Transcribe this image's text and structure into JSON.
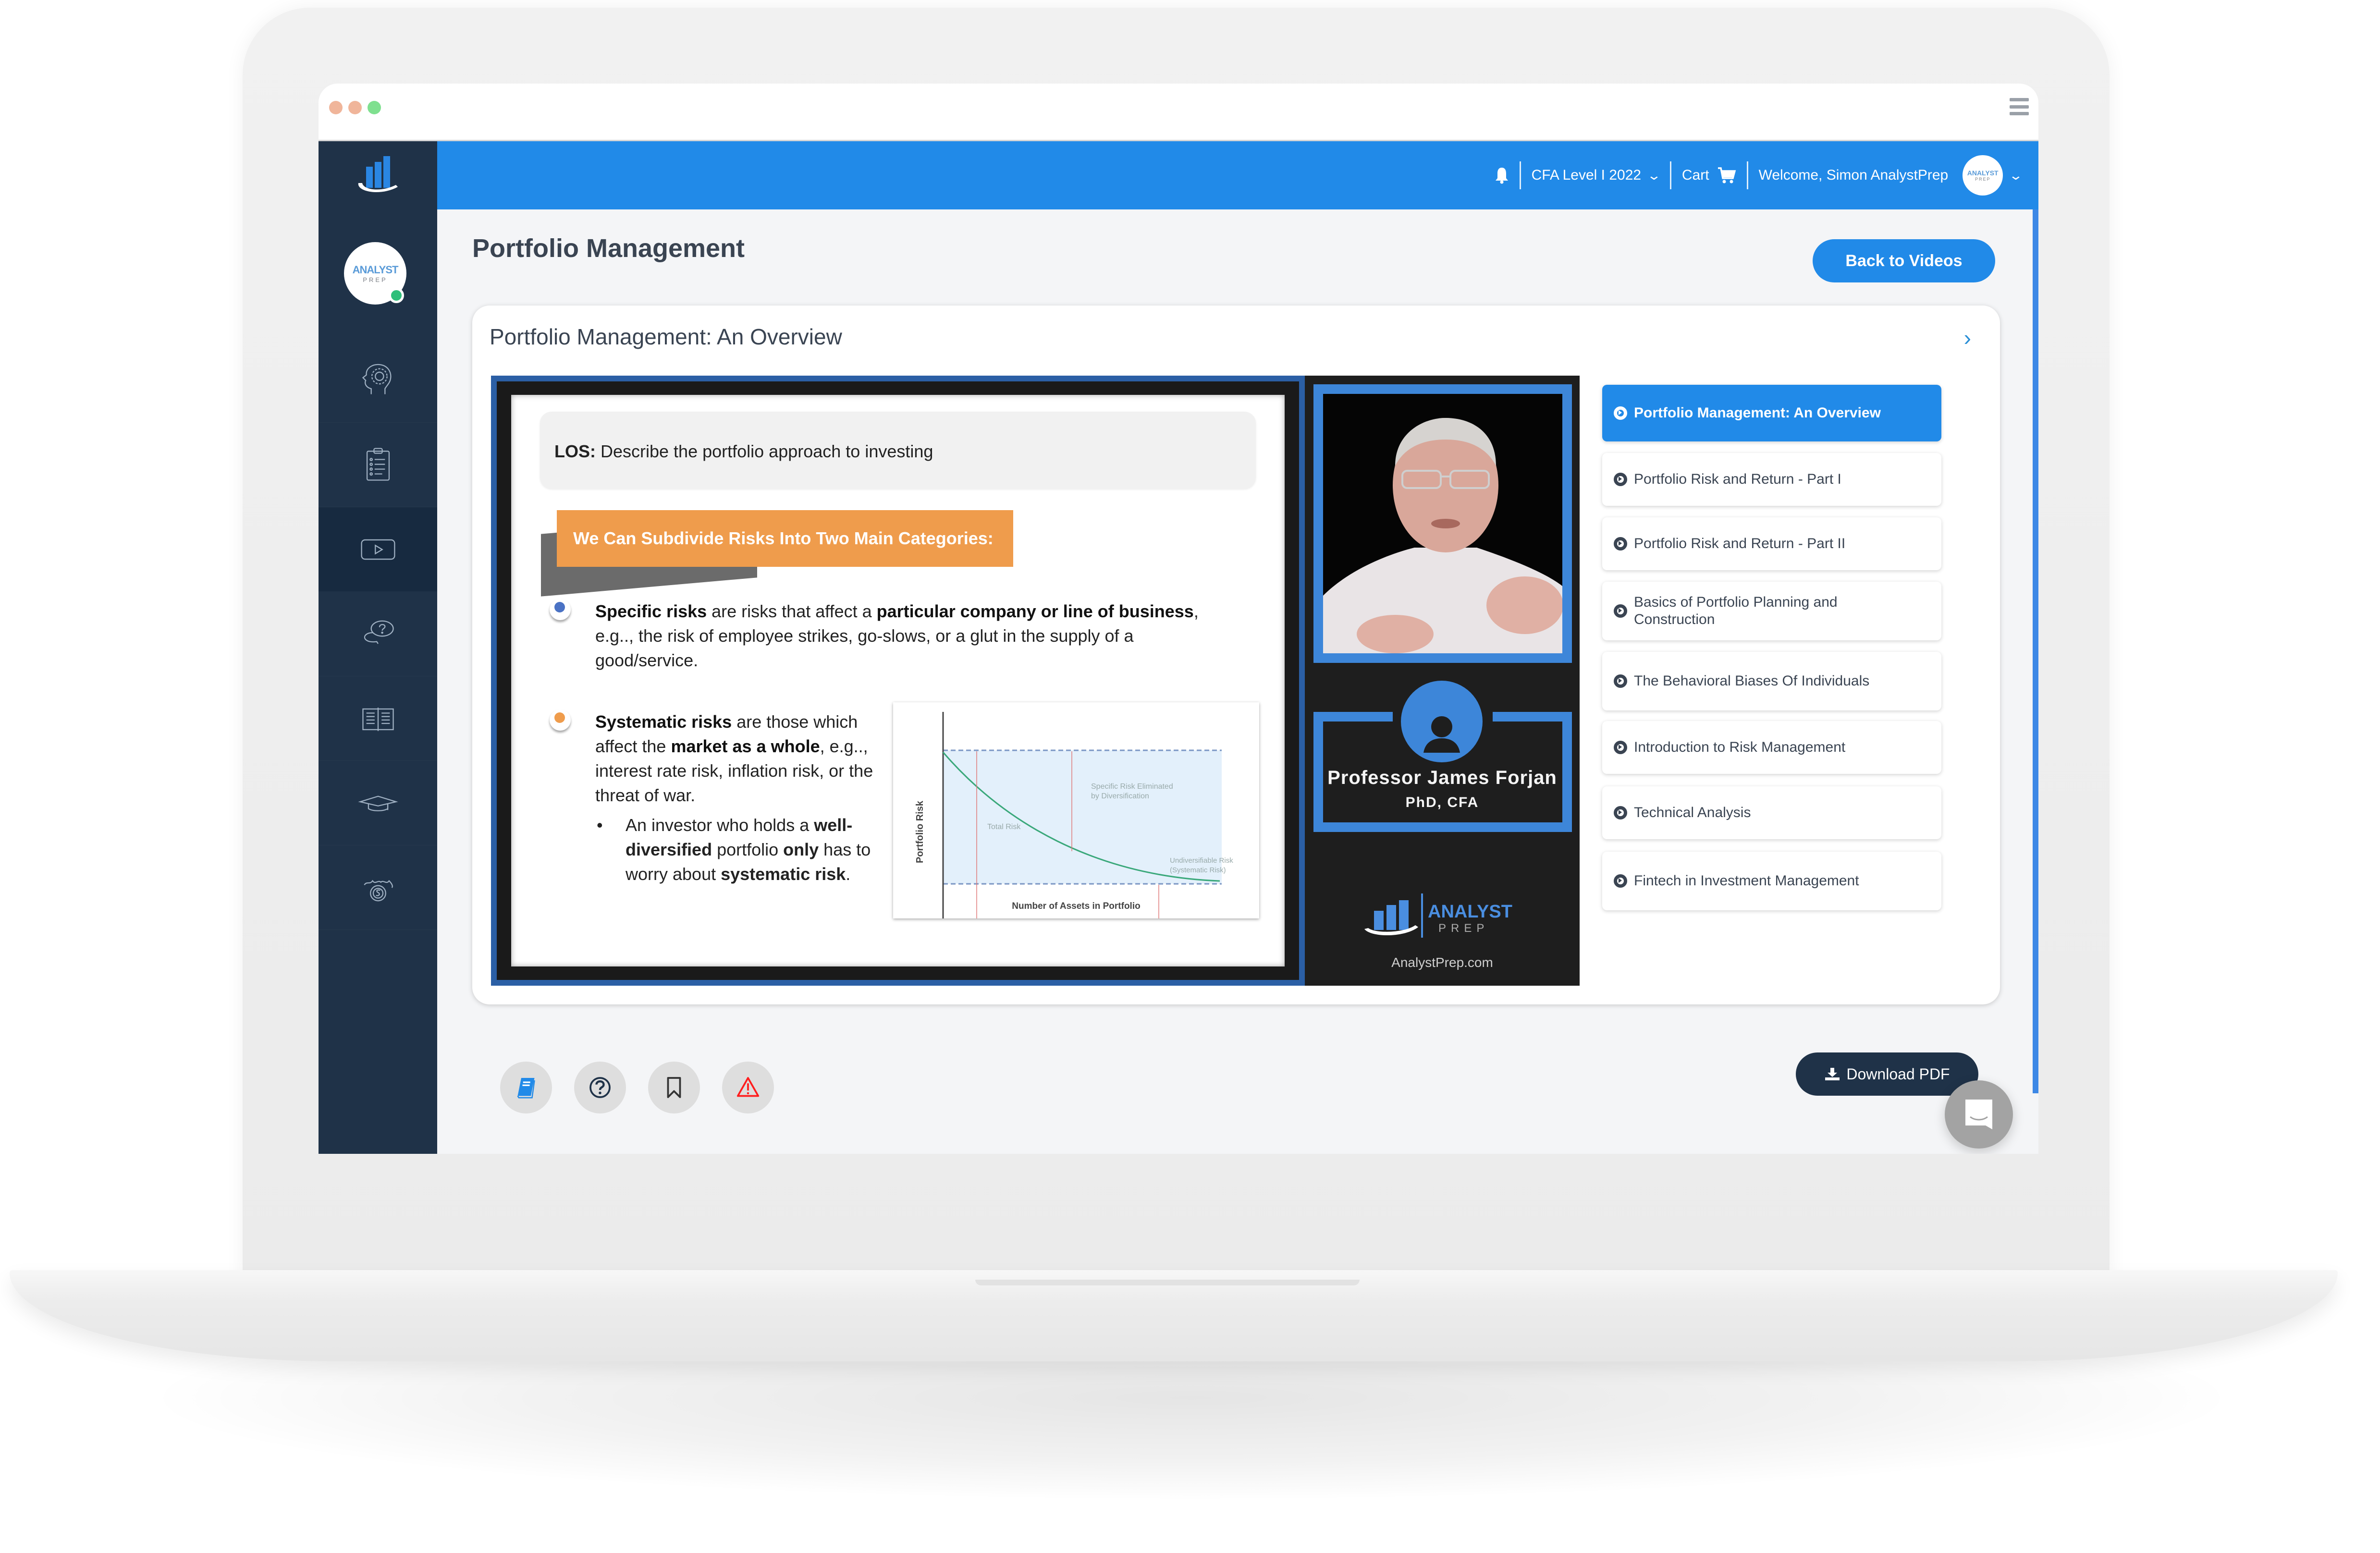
{
  "window": {
    "traffic_lights": [
      "close",
      "minimize",
      "maximize"
    ],
    "menu_icon": "hamburger-icon"
  },
  "brand": {
    "logo_icon": "analystprep-bars-logo",
    "avatar_line1": "ANALYST",
    "avatar_line2": "PREP",
    "online_color": "#2fbf7a"
  },
  "sidebar": {
    "items": [
      {
        "icon": "head-gear-icon",
        "label": "Learn"
      },
      {
        "icon": "clipboard-checklist-icon",
        "label": "Practice"
      },
      {
        "icon": "video-play-icon",
        "label": "Videos",
        "active": true
      },
      {
        "icon": "question-chat-icon",
        "label": "Q&A"
      },
      {
        "icon": "open-book-icon",
        "label": "Study Notes"
      },
      {
        "icon": "graduation-cap-icon",
        "label": "Exams"
      },
      {
        "icon": "crown-coin-icon",
        "label": "Rewards"
      }
    ]
  },
  "header": {
    "notification_icon": "bell-icon",
    "course_selector": "CFA Level I 2022",
    "cart_label": "Cart",
    "cart_icon": "cart-icon",
    "welcome": "Welcome, Simon AnalystPrep",
    "avatar_line1": "ANALYST",
    "avatar_line2": "PREP",
    "accent": "#218ae8"
  },
  "page": {
    "title": "Portfolio Management",
    "back_button": "Back to Videos"
  },
  "card": {
    "title": "Portfolio Management: An Overview",
    "next_icon": "chevron-right-icon"
  },
  "slide": {
    "los_label": "LOS:",
    "los_text": " Describe the portfolio approach to investing",
    "banner": "We Can Subdivide Risks Into Two Main Categories:",
    "bullet1": {
      "parts": [
        {
          "t": "Specific risks",
          "b": true
        },
        {
          "t": " are risks that affect a ",
          "b": false
        },
        {
          "t": "particular company or line of business",
          "b": true
        },
        {
          "t": ", e.g.., the risk of employee strikes, go-slows, or a glut in the supply of a good/service.",
          "b": false
        }
      ],
      "color": "#4a72c4"
    },
    "bullet2": {
      "parts": [
        {
          "t": "Systematic risks",
          "b": true
        },
        {
          "t": " are those which affect the ",
          "b": false
        },
        {
          "t": "market as a whole",
          "b": true
        },
        {
          "t": ", e.g.., interest rate risk, inflation risk, or the threat of war.",
          "b": false
        }
      ],
      "color": "#ef9c4c"
    },
    "sub_bullet": {
      "parts": [
        {
          "t": "An investor who holds a ",
          "b": false
        },
        {
          "t": "well-diversified",
          "b": true
        },
        {
          "t": " portfolio ",
          "b": false
        },
        {
          "t": "only",
          "b": true
        },
        {
          "t": " has to worry about ",
          "b": false
        },
        {
          "t": "systematic risk",
          "b": true
        },
        {
          "t": ".",
          "b": false
        }
      ]
    },
    "diagram": {
      "ylabel": "Portfolio Risk",
      "xlabel": "Number of Assets in Portfolio",
      "label_specific": [
        "Specific Risk Eliminated",
        "by Diversification"
      ],
      "label_total": "Total Risk",
      "label_systematic": [
        "Undiversifiable Risk",
        "(Systematic Risk)"
      ],
      "curve_color": "#3aa87a",
      "band_color": "#e3f0fb",
      "dash_color": "#7b97c4",
      "arrow_color": "#e07b7b"
    }
  },
  "presenter": {
    "name": "Professor James Forjan",
    "credentials": "PhD, CFA",
    "brand_line1": "ANALYST",
    "brand_line2": "PREP",
    "url": "AnalystPrep.com"
  },
  "lessons": [
    {
      "title": "Portfolio Management: An Overview",
      "active": true
    },
    {
      "title": "Portfolio Risk and Return - Part I",
      "active": false
    },
    {
      "title": "Portfolio Risk and Return - Part II",
      "active": false
    },
    {
      "title": "Basics of Portfolio Planning and Construction",
      "active": false
    },
    {
      "title": "The Behavioral Biases Of Individuals",
      "active": false
    },
    {
      "title": "Introduction to Risk Management",
      "active": false
    },
    {
      "title": "Technical Analysis",
      "active": false
    },
    {
      "title": "Fintech in Investment Management",
      "active": false
    }
  ],
  "actions": [
    {
      "icon": "book-icon",
      "label": "Notes",
      "color": "#218ae8"
    },
    {
      "icon": "question-circle-icon",
      "label": "Ask a Question",
      "color": "#1f3248"
    },
    {
      "icon": "bookmark-icon",
      "label": "Bookmark",
      "color": "#333333"
    },
    {
      "icon": "warning-icon",
      "label": "Report Issue",
      "color": "#ff1e1e"
    }
  ],
  "download": {
    "label": "Download PDF",
    "icon": "download-icon"
  },
  "chat": {
    "icon": "chat-bubble-icon"
  }
}
